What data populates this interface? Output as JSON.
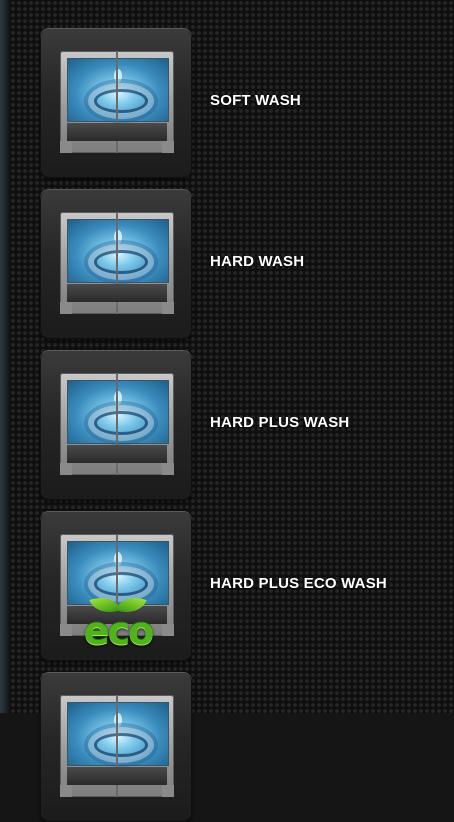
{
  "programs": [
    {
      "label": "SOFT WASH",
      "icon": "washing-machine-icon",
      "eco": false
    },
    {
      "label": "HARD WASH",
      "icon": "washing-machine-icon",
      "eco": false
    },
    {
      "label": "HARD PLUS WASH",
      "icon": "washing-machine-icon",
      "eco": false
    },
    {
      "label": "HARD PLUS ECO WASH",
      "icon": "washing-machine-icon",
      "eco": true,
      "badge": "eco"
    },
    {
      "label": "",
      "icon": "washing-machine-icon",
      "eco": false
    }
  ],
  "colors": {
    "label": "#ffffff",
    "eco_green": "#4fb41c",
    "background": "#151515"
  }
}
